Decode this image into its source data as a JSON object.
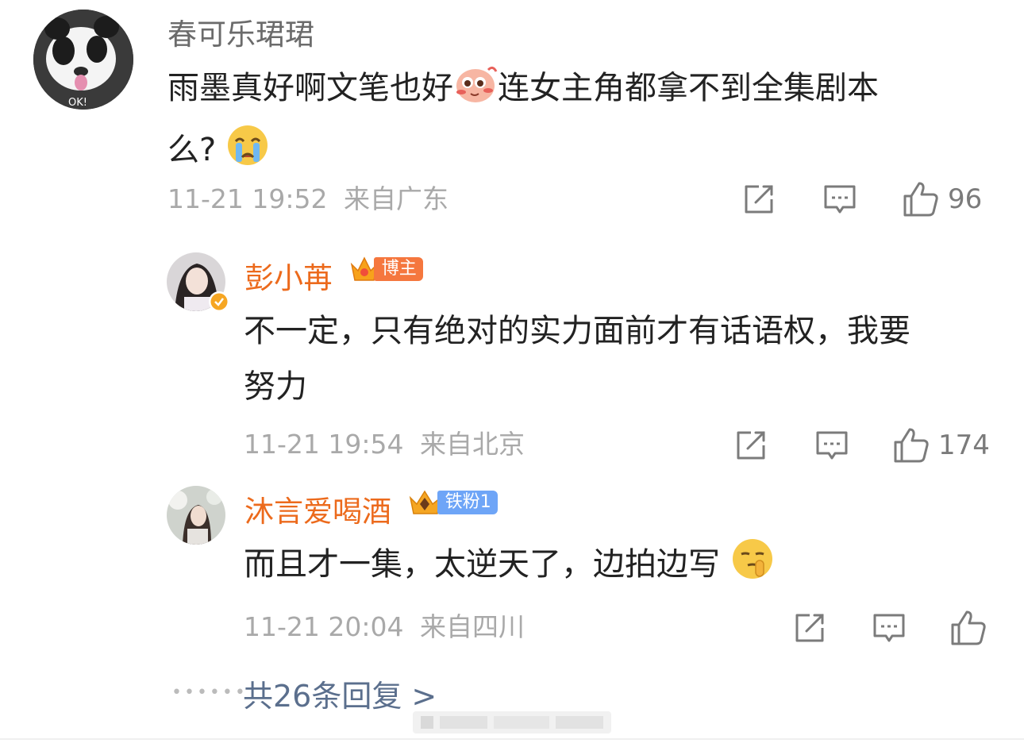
{
  "comments": [
    {
      "username": "春可乐珺珺",
      "avatar_label": "OK!",
      "text_line1": "雨墨真好啊文笔也好",
      "text_line1b": "连女主角都拿不到全集剧本",
      "text_line2": "么?",
      "emoji1": "blushing-monkey-emoji",
      "emoji2": "crying-face-emoji",
      "date": "11-21 19:52",
      "location": "来自广东",
      "like_count": "96"
    },
    {
      "username": "彭小苒",
      "badge_label": "博主",
      "badge_color": "#f5773e",
      "text_line1": "不一定，只有绝对的实力面前才有话语权，我要",
      "text_line2": "努力",
      "date": "11-21 19:54",
      "location": "来自北京",
      "like_count": "174"
    },
    {
      "username": "沐言爱喝酒",
      "badge_label": "铁粉1",
      "badge_color": "#6ea5f7",
      "text_line1": "而且才一集，太逆天了，边拍边写",
      "emoji": "shushing-face-emoji",
      "date": "11-21 20:04",
      "location": "来自四川",
      "like_count": ""
    }
  ],
  "more_replies": "共26条回复 >",
  "colors": {
    "username_primary": "#6b6b6b",
    "username_reply": "#ec6a1c",
    "meta": "#a9a9a9",
    "more_link": "#5b6f8d"
  }
}
